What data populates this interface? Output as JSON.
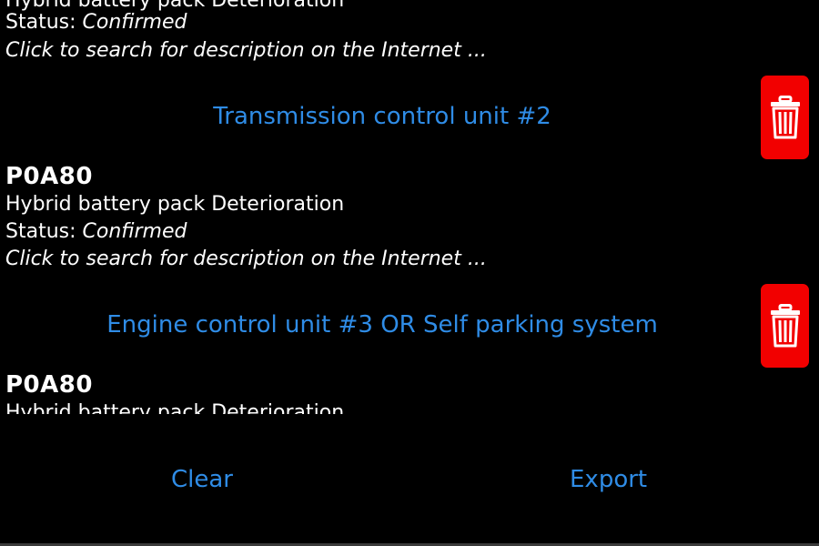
{
  "entries": [
    {
      "description": "Hybrid battery pack Deterioration",
      "status_label": "Status: ",
      "status_value": "Confirmed",
      "search_text": "Click to search for description on the Internet ..."
    },
    {
      "unit": "Transmission control unit #2",
      "code": "P0A80",
      "description": "Hybrid battery pack Deterioration",
      "status_label": "Status: ",
      "status_value": "Confirmed",
      "search_text": "Click to search for description on the Internet ..."
    },
    {
      "unit": "Engine control unit #3 OR Self parking system",
      "code": "P0A80",
      "description": "Hybrid battery pack Deterioration"
    }
  ],
  "toolbar": {
    "clear_label": "Clear",
    "export_label": "Export"
  },
  "icons": {
    "delete": "trash-icon"
  },
  "colors": {
    "background": "#000000",
    "accent": "#2f8ce6",
    "delete": "#f20000",
    "text": "#ffffff"
  }
}
